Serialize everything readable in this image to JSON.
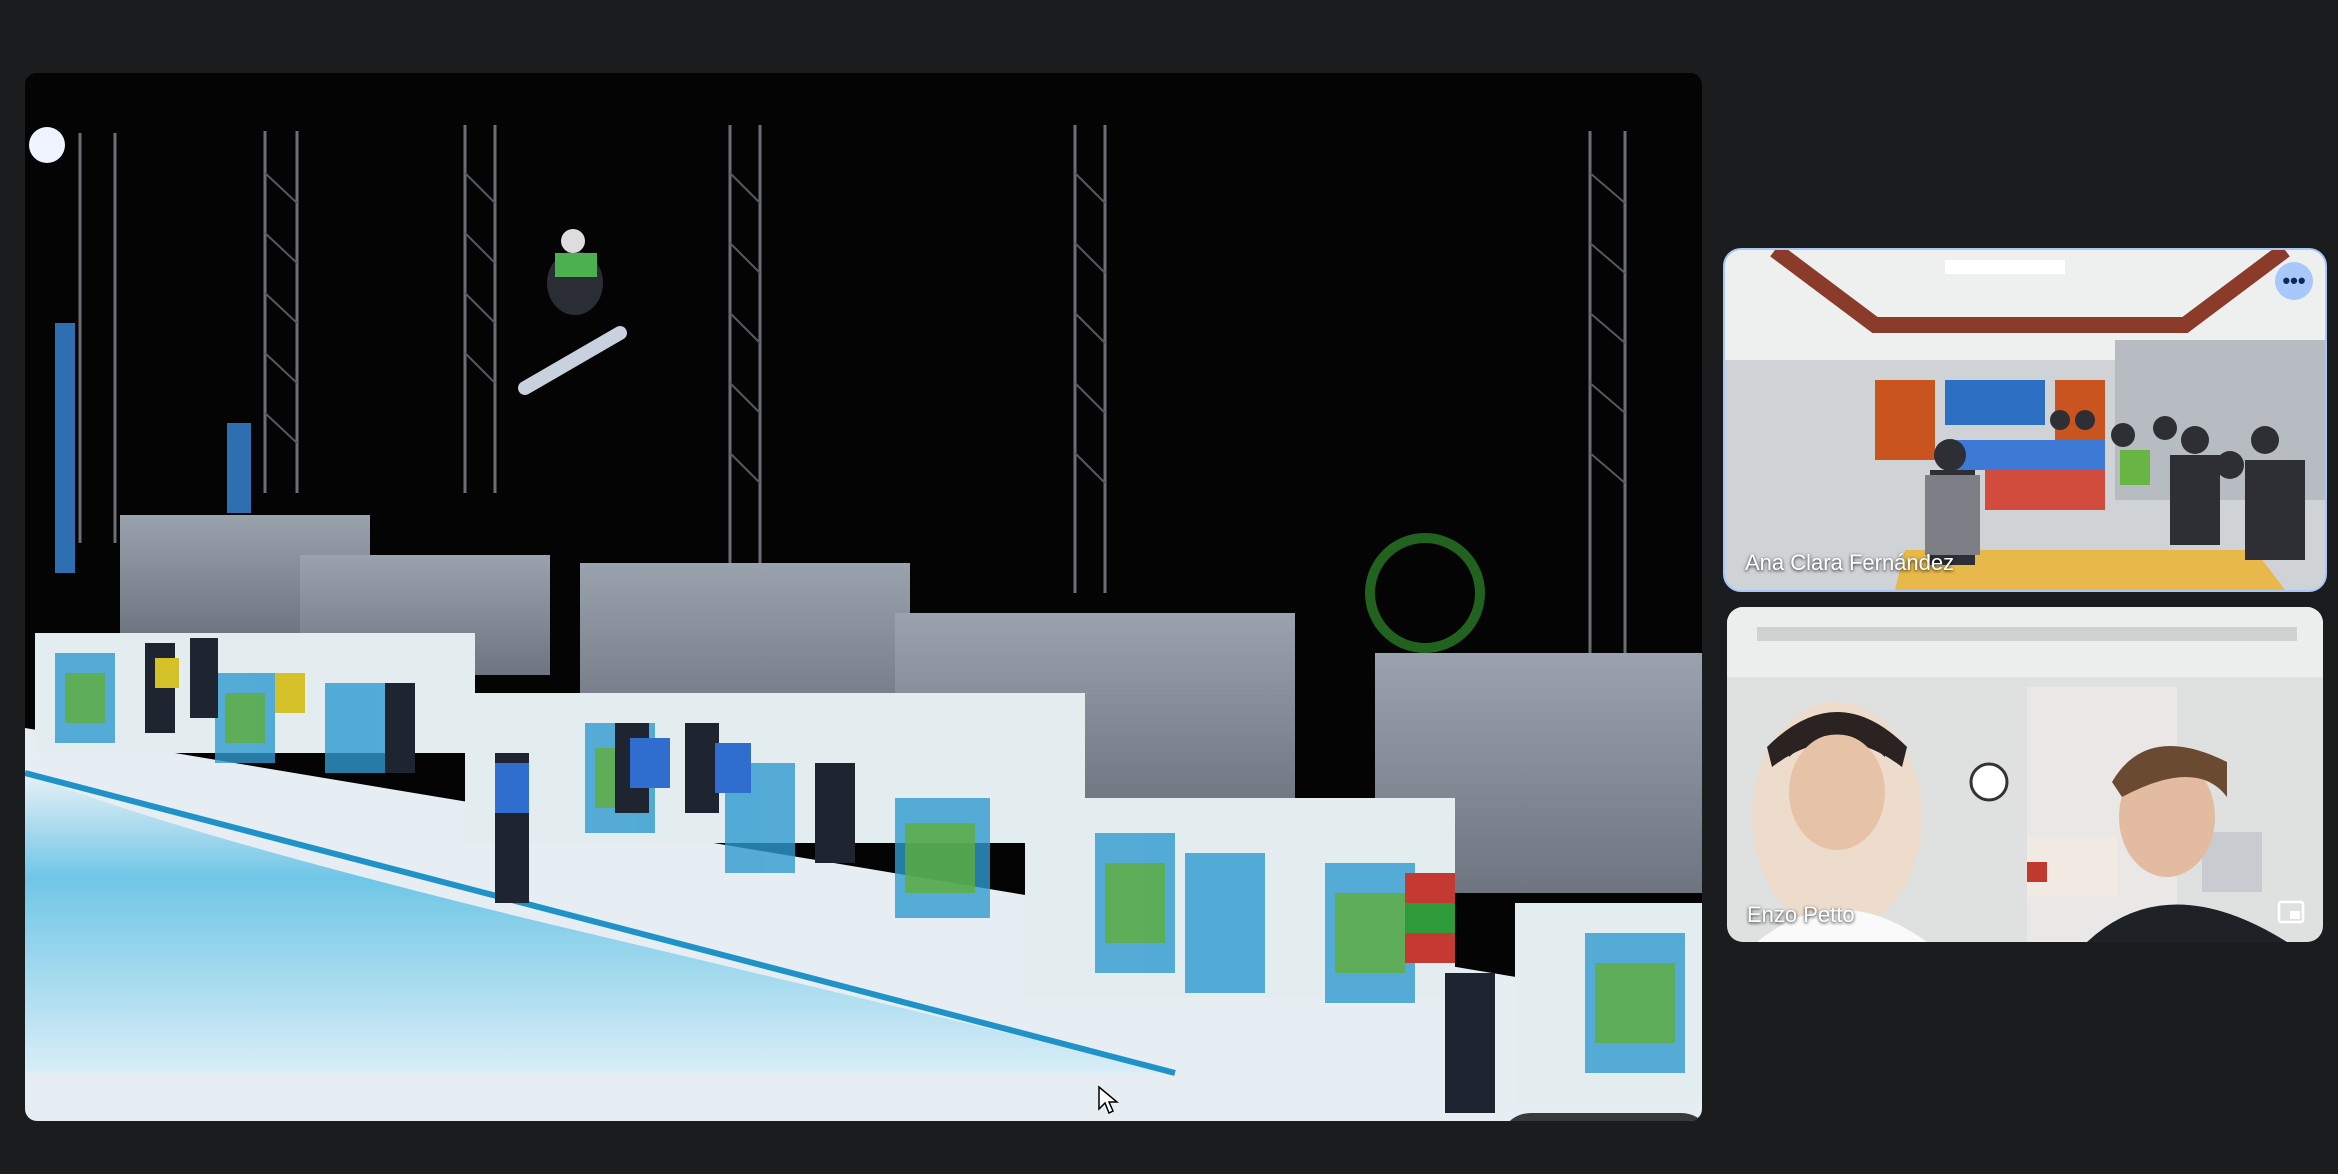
{
  "presentation": {
    "description_icon_names": [
      "swap-layout-icon",
      "fullscreen-icon",
      "share-icon"
    ]
  },
  "participants": [
    {
      "name": "Ana Clara Fernández",
      "active_speaker": true
    },
    {
      "name": "Enzo Petto",
      "active_speaker": false
    }
  ],
  "colors": {
    "background": "#1b1c1e",
    "active_outline": "#a8c7fa",
    "more_button": "#a8c7fa"
  }
}
